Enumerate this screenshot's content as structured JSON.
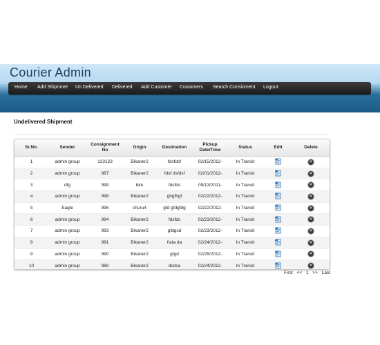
{
  "app": {
    "title": "Courier Admin"
  },
  "nav": {
    "items": [
      {
        "label": "Home"
      },
      {
        "label": "Add Shipmnet"
      },
      {
        "label": "Un Delivered"
      },
      {
        "label": "Delivered"
      },
      {
        "label": "Add Customer"
      },
      {
        "label": "Customers"
      },
      {
        "label": "Search Consinment"
      },
      {
        "label": "Logout"
      }
    ]
  },
  "page": {
    "title": "Undelivered Shipment"
  },
  "table": {
    "headers": {
      "srno": "Sr.No.",
      "sender": "Sender",
      "consignment_line1": "Consignment",
      "consignment_line2": "No",
      "origin": "Origin",
      "destination": "Destination",
      "pickup_line1": "Pickup",
      "pickup_line2": "Date/Time",
      "status": "Status",
      "edit": "Edit",
      "delete": "Delete"
    },
    "rows": [
      {
        "srno": "1",
        "sender": "admin group",
        "consignment": "123123",
        "origin": "Bikaner2",
        "destination": "fdsfdsf",
        "pickup": "02/15/2012-",
        "status": "In Transit"
      },
      {
        "srno": "2",
        "sender": "admin group",
        "consignment": "987",
        "origin": "Bikaner2",
        "destination": "fdsf dsfdsf",
        "pickup": "02/01/2012-",
        "status": "In Transit"
      },
      {
        "srno": "3",
        "sender": "dfg",
        "consignment": "999",
        "origin": "bkn",
        "destination": "fdsfds",
        "pickup": "09/13/2011-",
        "status": "In Transit"
      },
      {
        "srno": "4",
        "sender": "admin group",
        "consignment": "998",
        "origin": "Bikaner2",
        "destination": "ghgfhgf",
        "pickup": "02/22/2012-",
        "status": "In Transit"
      },
      {
        "srno": "5",
        "sender": "Eagle",
        "consignment": "996",
        "origin": "churu4",
        "destination": "gfd gfdgfdg",
        "pickup": "02/22/2012-",
        "status": "In Transit"
      },
      {
        "srno": "6",
        "sender": "admin group",
        "consignment": "994",
        "origin": "Bikaner2",
        "destination": "fdsfds",
        "pickup": "02/23/2012-",
        "status": "In Transit"
      },
      {
        "srno": "7",
        "sender": "admin group",
        "consignment": "993",
        "origin": "Bikaner2",
        "destination": "gfdgsd",
        "pickup": "02/23/2012-",
        "status": "In Transit"
      },
      {
        "srno": "8",
        "sender": "admin group",
        "consignment": "991",
        "origin": "Bikaner2",
        "destination": "fsda da",
        "pickup": "02/24/2012-",
        "status": "In Transit"
      },
      {
        "srno": "9",
        "sender": "admin group",
        "consignment": "990",
        "origin": "Bikaner2",
        "destination": "gfgd",
        "pickup": "02/25/2012-",
        "status": "In Transit"
      },
      {
        "srno": "10",
        "sender": "admin group",
        "consignment": "989",
        "origin": "Bikaner2",
        "destination": "dsdsa",
        "pickup": "02/24/2012-",
        "status": "In Transit"
      }
    ]
  },
  "pager": {
    "first": "First",
    "prev": "<<",
    "page": "1",
    "next": ">>",
    "last": "Last"
  },
  "colors": {
    "title": "#1b3f63",
    "navbar": "#2a2a2a",
    "banner_top": "#cfe6f7",
    "banner_bottom": "#1c5a86"
  },
  "icons": {
    "edit": "edit-document-icon",
    "delete": "delete-circle-icon"
  }
}
